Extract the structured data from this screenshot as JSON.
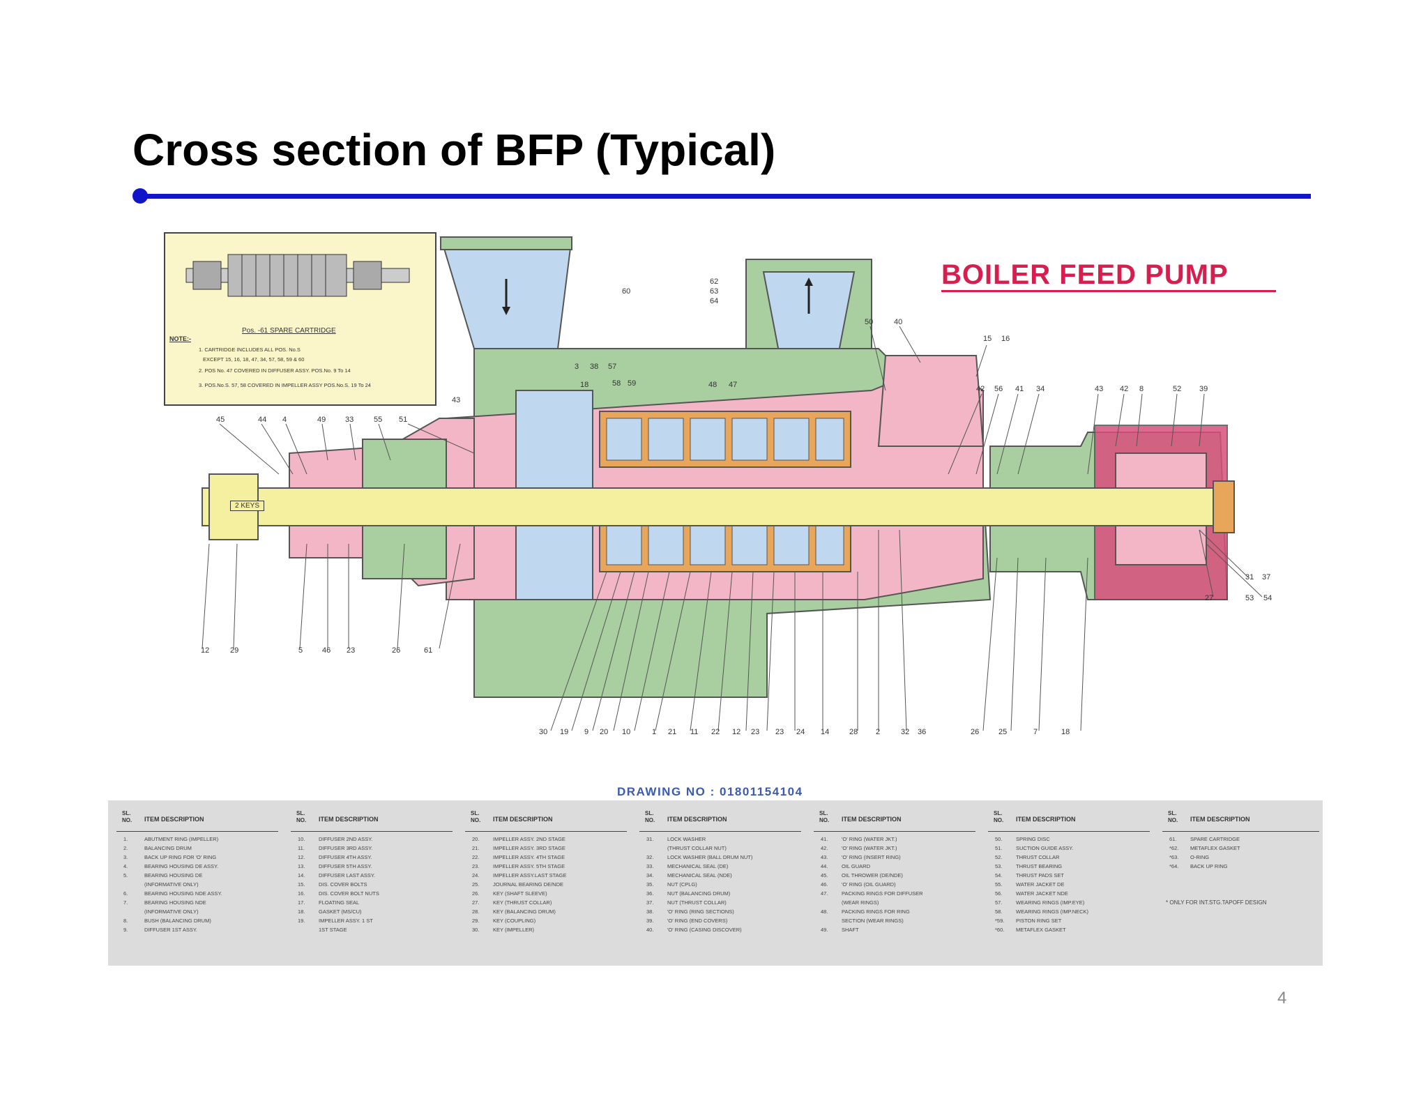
{
  "slide": {
    "title": "Cross section of BFP (Typical)",
    "page_number": "4"
  },
  "drawing": {
    "heading": "BOILER FEED PUMP",
    "drawing_no": "DRAWING NO : 01801154104",
    "key_label": "2 KEYS",
    "inset": {
      "caption": "Pos. -61 SPARE CARTRIDGE",
      "note_label": "NOTE:-",
      "notes": [
        "1. CARTRIDGE INCLUDES ALL POS. No.S",
        "EXCEPT 15, 16, 18, 47, 34, 57, 58, 59 & 60",
        "2. POS No. 47 COVERED IN DIFFUSER ASSY. POS.No. 9 To 14",
        "3. POS.No.S. 57, 58 COVERED IN IMPELLER ASSY POS.No.S. 19 To 24"
      ]
    },
    "callouts_top": [
      "45",
      "44",
      "4",
      "49",
      "33",
      "55",
      "51",
      "43",
      "3",
      "38",
      "57",
      "18",
      "58",
      "59",
      "60",
      "62",
      "63",
      "64",
      "48",
      "47",
      "50",
      "40",
      "15",
      "16",
      "42",
      "56",
      "41",
      "34",
      "43",
      "42",
      "8",
      "52",
      "39"
    ],
    "callouts_bottom": [
      "12",
      "29",
      "5",
      "46",
      "23",
      "26",
      "61",
      "30",
      "19",
      "9",
      "20",
      "10",
      "1",
      "21",
      "11",
      "22",
      "12",
      "23",
      "23",
      "24",
      "14",
      "28",
      "2",
      "32",
      "36",
      "26",
      "25",
      "7",
      "18",
      "31",
      "37",
      "27",
      "53",
      "54"
    ]
  },
  "parts_table": {
    "sl_header": "SL. NO.",
    "desc_header": "ITEM DESCRIPTION",
    "columns": [
      [
        {
          "no": "1.",
          "desc": "ABUTMENT RING (IMPELLER)"
        },
        {
          "no": "2.",
          "desc": "BALANCING DRUM"
        },
        {
          "no": "3.",
          "desc": "BACK UP RING FOR 'O' RING"
        },
        {
          "no": "4.",
          "desc": "BEARING HOUSING DE ASSY."
        },
        {
          "no": "5.",
          "desc": "BEARING HOUSING DE"
        },
        {
          "no": "",
          "desc": "(INFORMATIVE ONLY)"
        },
        {
          "no": "6.",
          "desc": "BEARING HOUSING NDE ASSY."
        },
        {
          "no": "7.",
          "desc": "BEARING HOUSING NDE"
        },
        {
          "no": "",
          "desc": "(INFORMATIVE ONLY)"
        },
        {
          "no": "8.",
          "desc": "BUSH (BALANCING DRUM)"
        },
        {
          "no": "9.",
          "desc": "DIFFUSER 1ST ASSY."
        }
      ],
      [
        {
          "no": "10.",
          "desc": "DIFFUSER 2ND ASSY."
        },
        {
          "no": "11.",
          "desc": "DIFFUSER 3RD ASSY."
        },
        {
          "no": "12.",
          "desc": "DIFFUSER 4TH ASSY."
        },
        {
          "no": "13.",
          "desc": "DIFFUSER 5TH ASSY."
        },
        {
          "no": "14.",
          "desc": "DIFFUSER LAST ASSY."
        },
        {
          "no": "15.",
          "desc": "DIS. COVER BOLTS"
        },
        {
          "no": "16.",
          "desc": "DIS. COVER BOLT NUTS"
        },
        {
          "no": "17.",
          "desc": "FLOATING SEAL"
        },
        {
          "no": "18.",
          "desc": "GASKET (MS/CU)"
        },
        {
          "no": "19.",
          "desc": "IMPELLER ASSY. 1 ST"
        },
        {
          "no": "",
          "desc": "1ST STAGE"
        }
      ],
      [
        {
          "no": "20.",
          "desc": "IMPELLER ASSY. 2ND STAGE"
        },
        {
          "no": "21.",
          "desc": "IMPELLER ASSY. 3RD STAGE"
        },
        {
          "no": "22.",
          "desc": "IMPELLER ASSY. 4TH STAGE"
        },
        {
          "no": "23.",
          "desc": "IMPELLER ASSY. 5TH STAGE"
        },
        {
          "no": "24.",
          "desc": "IMPELLER ASSY.LAST STAGE"
        },
        {
          "no": "25.",
          "desc": "JOURNAL BEARING DE/NDE"
        },
        {
          "no": "26.",
          "desc": "KEY (SHAFT SLEEVE)"
        },
        {
          "no": "27.",
          "desc": "KEY (THRUST COLLAR)"
        },
        {
          "no": "28.",
          "desc": "KEY (BALANCING DRUM)"
        },
        {
          "no": "29.",
          "desc": "KEY (COUPLING)"
        },
        {
          "no": "30.",
          "desc": "KEY (IMPELLER)"
        }
      ],
      [
        {
          "no": "31.",
          "desc": "LOCK WASHER"
        },
        {
          "no": "",
          "desc": "(THRUST COLLAR NUT)"
        },
        {
          "no": "32.",
          "desc": "LOCK WASHER (BALL DRUM NUT)"
        },
        {
          "no": "33.",
          "desc": "MECHANICAL SEAL (DE)"
        },
        {
          "no": "34.",
          "desc": "MECHANICAL SEAL (NDE)"
        },
        {
          "no": "35.",
          "desc": "NUT (CPLG)"
        },
        {
          "no": "36.",
          "desc": "NUT (BALANCING DRUM)"
        },
        {
          "no": "37.",
          "desc": "NUT (THRUST COLLAR)"
        },
        {
          "no": "38.",
          "desc": "'O' RING (RING SECTIONS)"
        },
        {
          "no": "39.",
          "desc": "'O' RING (END COVERS)"
        },
        {
          "no": "40.",
          "desc": "'O' RING (CASING DISCOVER)"
        }
      ],
      [
        {
          "no": "41.",
          "desc": "'O' RING (WATER JKT.)"
        },
        {
          "no": "42.",
          "desc": "'O' RING (WATER JKT.)"
        },
        {
          "no": "43.",
          "desc": "'O' RING (INSERT RING)"
        },
        {
          "no": "44.",
          "desc": "OIL GUARD"
        },
        {
          "no": "45.",
          "desc": "OIL THROWER (DE/NDE)"
        },
        {
          "no": "46.",
          "desc": "'O' RING (OIL GUARD)"
        },
        {
          "no": "47.",
          "desc": "PACKING RINGS FOR DIFFUSER"
        },
        {
          "no": "",
          "desc": "(WEAR RINGS)"
        },
        {
          "no": "48.",
          "desc": "PACKING RINGS FOR RING"
        },
        {
          "no": "",
          "desc": "SECTION (WEAR RINGS)"
        },
        {
          "no": "49.",
          "desc": "SHAFT"
        }
      ],
      [
        {
          "no": "50.",
          "desc": "SPRING DISC"
        },
        {
          "no": "51.",
          "desc": "SUCTION GUIDE ASSY."
        },
        {
          "no": "52.",
          "desc": "THRUST COLLAR"
        },
        {
          "no": "53.",
          "desc": "THRUST BEARING"
        },
        {
          "no": "54.",
          "desc": "THRUST PADS SET"
        },
        {
          "no": "55.",
          "desc": "WATER JACKET DE"
        },
        {
          "no": "56.",
          "desc": "WATER JACKET NDE"
        },
        {
          "no": "57.",
          "desc": "WEARING RINGS (IMP.EYE)"
        },
        {
          "no": "58.",
          "desc": "WEARING RINGS (IMP.NECK)"
        },
        {
          "no": "*59.",
          "desc": "PISTON RING SET"
        },
        {
          "no": "*60.",
          "desc": "METAFLEX GASKET"
        }
      ],
      [
        {
          "no": "61.",
          "desc": "SPARE CARTRIDGE"
        },
        {
          "no": "*62.",
          "desc": "METAFLEX GASKET"
        },
        {
          "no": "*63.",
          "desc": "O-RING"
        },
        {
          "no": "*64.",
          "desc": "BACK UP RING"
        }
      ]
    ],
    "footnote": "* ONLY FOR INT.STG.TAPOFF DESIGN"
  },
  "colors": {
    "rule": "#1016c8",
    "heading": "#d61f4e",
    "casing_green": "#a9cfa1",
    "pink": "#f2b6c6",
    "light_blue": "#bfd8ef",
    "shaft_yellow": "#f5f0a0",
    "impeller_orange": "#e8a65a",
    "bearing_magenta": "#d9507c"
  }
}
